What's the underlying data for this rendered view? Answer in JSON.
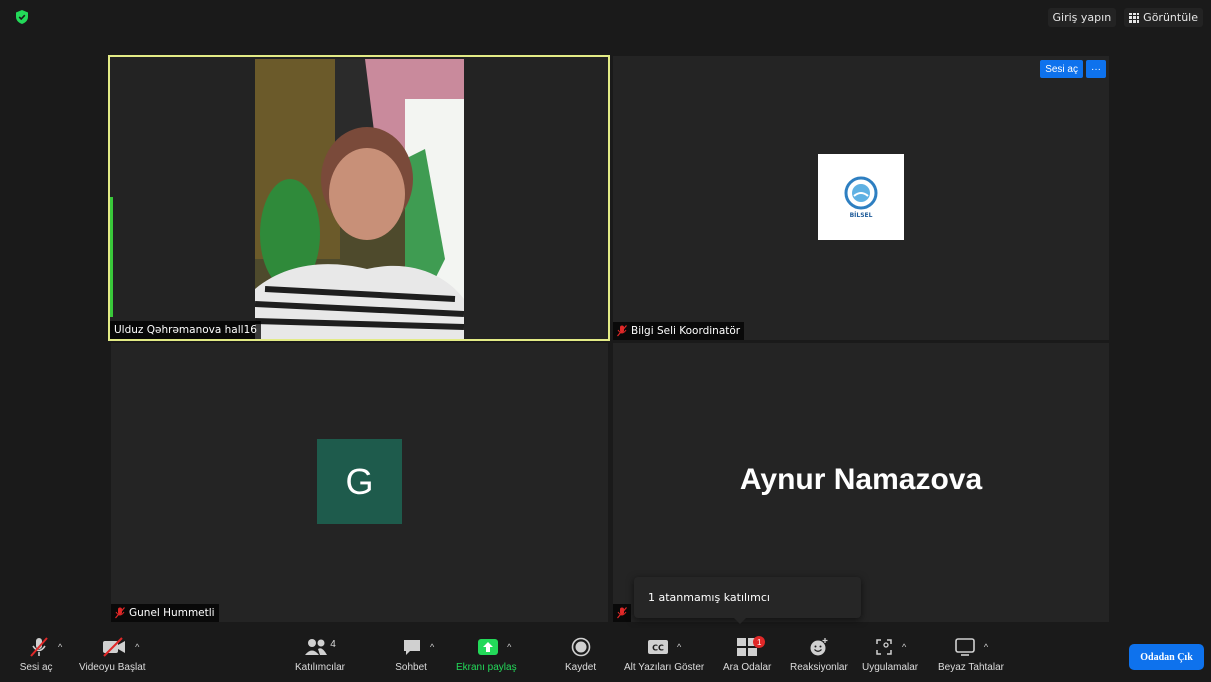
{
  "topbar": {
    "signin_label": "Giriş yapın",
    "view_label": "Görüntüle"
  },
  "tiles": {
    "t1": {
      "name": "Ulduz Qəhrəmanova hall16"
    },
    "t2": {
      "name": "Bilgi Seli Koordinatör",
      "unmute_label": "Sesi aç",
      "more_label": "···",
      "logo_text": "BİLSEL"
    },
    "t3": {
      "name": "Gunel Hummetli",
      "avatar_letter": "G"
    },
    "t4": {
      "name_large": "Aynur Namazova"
    }
  },
  "tooltip": {
    "text": "1 atanmamış katılımcı"
  },
  "toolbar": {
    "unmute": "Sesi aç",
    "start_video": "Videoyu Başlat",
    "participants": "Katılımcılar",
    "participants_count": "4",
    "chat": "Sohbet",
    "share": "Ekranı paylaş",
    "record": "Kaydet",
    "captions": "Alt Yazıları Göster",
    "captions_icon_text": "CC",
    "breakout": "Ara Odalar",
    "breakout_badge": "1",
    "reactions": "Reaksiyonlar",
    "apps": "Uygulamalar",
    "whiteboards": "Beyaz Tahtalar",
    "leave": "Odadan Çık"
  },
  "colors": {
    "accent_blue": "#0e72ed",
    "share_green": "#23d959",
    "active_speaker_border": "#e3eb86",
    "avatar_bg": "#1e5b4c"
  }
}
